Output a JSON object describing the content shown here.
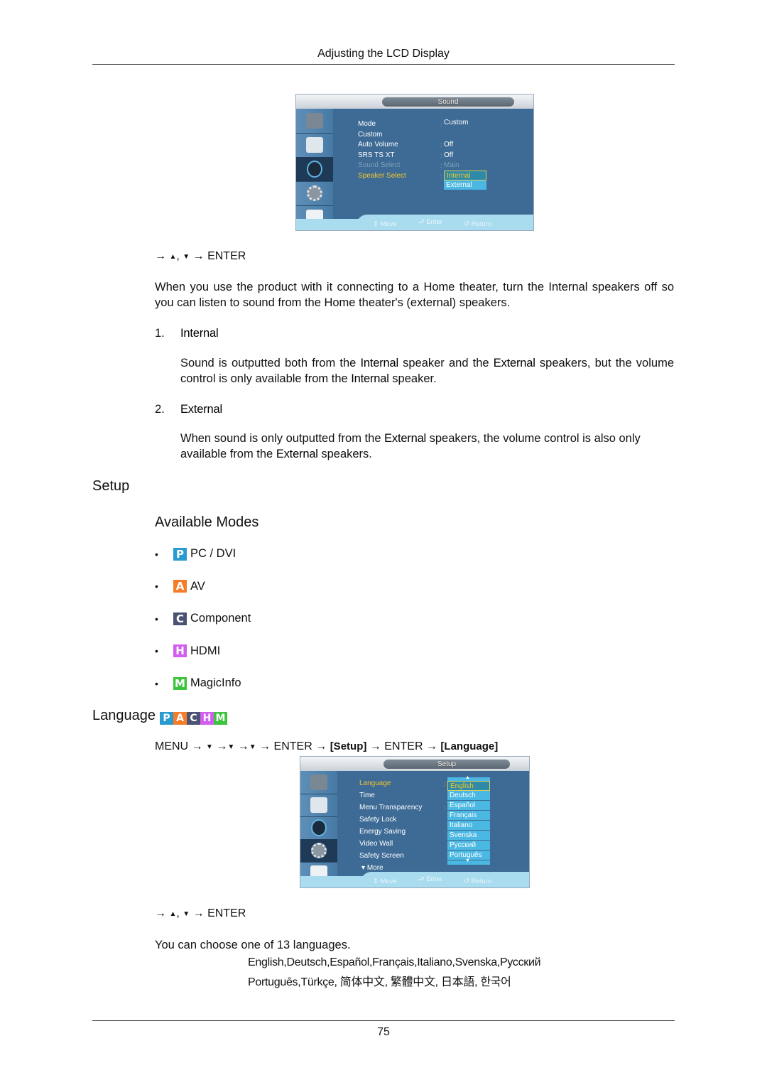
{
  "header": {
    "title": "Adjusting the LCD Display"
  },
  "sound_osd": {
    "title": "Sound",
    "side_icons": [
      "input-icon",
      "picture-icon",
      "sound-icon",
      "setup-icon",
      "multi-control-icon"
    ],
    "active_side_index": 2,
    "menu_items": [
      {
        "label": "Mode",
        "value": "Custom",
        "state": "normal"
      },
      {
        "label": "Custom",
        "value": "",
        "state": "normal"
      },
      {
        "label": "Auto Volume",
        "value": "Off",
        "state": "normal"
      },
      {
        "label": "SRS TS XT",
        "value": "Off",
        "state": "normal"
      },
      {
        "label": "Sound Select",
        "value": "Main",
        "state": "dim"
      },
      {
        "label": "Speaker Select",
        "value": "",
        "state": "selected"
      }
    ],
    "options": [
      "Internal",
      "External"
    ],
    "selected_option": "Internal",
    "footer": {
      "move": "Move",
      "enter": "Enter",
      "return": "Return"
    }
  },
  "sound_nav": {
    "prefix": "→",
    "up": "▲",
    "sep": ",",
    "down": "▼",
    "suffix": "→ ENTER"
  },
  "intro_paragraph": "When you use the product with it connecting to a Home theater, turn the Internal speakers off so you can listen to sound from the Home theater's (external) speakers.",
  "speaker_options": [
    {
      "number": "1.",
      "title": "Internal",
      "desc_parts": [
        "Sound is outputted both from the ",
        "Internal",
        " speaker and the ",
        "External",
        " speakers, but the volume control is only available from the ",
        "Internal",
        " speaker."
      ]
    },
    {
      "number": "2.",
      "title": "External",
      "desc_parts": [
        "When sound is only outputted from the ",
        "External",
        " speakers, the volume control is also only available from the ",
        "External",
        " speakers."
      ]
    }
  ],
  "setup_section": {
    "title": "Setup",
    "available_modes_title": "Available Modes",
    "modes": [
      {
        "letter": "P",
        "label": "PC / DVI",
        "color": "#2a9bd0"
      },
      {
        "letter": "A",
        "label": "AV",
        "color": "#f57d2a"
      },
      {
        "letter": "C",
        "label": "Component",
        "color": "#4a5472"
      },
      {
        "letter": "H",
        "label": "HDMI",
        "color": "#d15ef0"
      },
      {
        "letter": "M",
        "label": "MagicInfo",
        "color": "#3cc43c"
      }
    ],
    "bullet": "•"
  },
  "language_section": {
    "title": "Language",
    "badges": [
      {
        "letter": "P",
        "color": "#2a9bd0"
      },
      {
        "letter": "A",
        "color": "#f57d2a"
      },
      {
        "letter": "C",
        "color": "#4a5472"
      },
      {
        "letter": "H",
        "color": "#d15ef0"
      },
      {
        "letter": "M",
        "color": "#3cc43c"
      }
    ],
    "path": {
      "menu": "MENU",
      "arrow": "→",
      "down": "▼",
      "enter": "ENTER",
      "setup_bracket": "[Setup]",
      "language_bracket": "[Language]"
    }
  },
  "setup_osd": {
    "title": "Setup",
    "side_icons": [
      "input-icon",
      "picture-icon",
      "sound-icon",
      "setup-icon",
      "multi-control-icon"
    ],
    "active_side_index": 3,
    "menu_items": [
      {
        "label": "Language",
        "state": "selected",
        "colon": true
      },
      {
        "label": "Time",
        "state": "normal",
        "colon": false
      },
      {
        "label": "Menu Transparency",
        "state": "normal",
        "colon": true
      },
      {
        "label": "Safety Lock",
        "state": "normal",
        "colon": false
      },
      {
        "label": "Energy Saving",
        "state": "normal",
        "colon": true
      },
      {
        "label": "Video Wall",
        "state": "normal",
        "colon": false
      },
      {
        "label": "Safety Screen",
        "state": "normal",
        "colon": false
      }
    ],
    "more_label": "More",
    "options": [
      "English",
      "Deutsch",
      "Español",
      "Français",
      "Italiano",
      "Svenska",
      "Русский",
      "Português"
    ],
    "selected_option": "English",
    "footer": {
      "move": "Move",
      "enter": "Enter",
      "return": "Return"
    }
  },
  "language_nav": {
    "prefix": "→",
    "up": "▲",
    "sep": ",",
    "down": "▼",
    "suffix": "→ ENTER"
  },
  "language_count_text": "You can choose one of 13 languages.",
  "language_list": {
    "line1": "English,Deutsch,Español,Français,Italiano,Svenska,Русский",
    "line2": "Português,Türkçe, 简体中文,  繁體中文, 日本語, 한국어"
  },
  "footer": {
    "page_number": "75"
  }
}
